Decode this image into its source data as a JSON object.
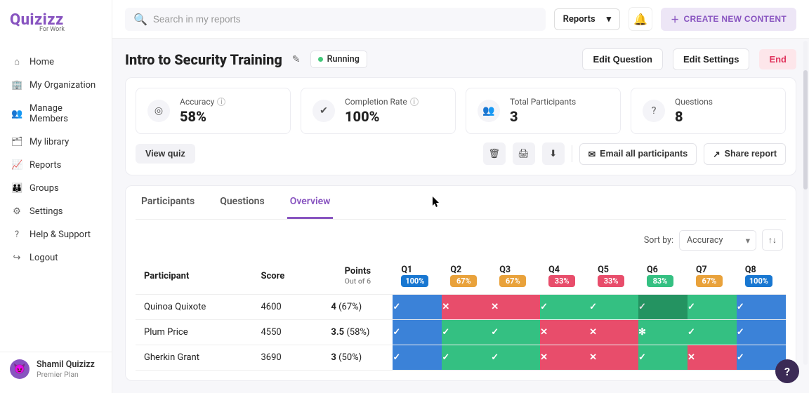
{
  "brand": {
    "name": "Quizizz",
    "tagline": "For Work"
  },
  "sidebar": {
    "items": [
      {
        "icon": "⌂",
        "name": "home",
        "label": "Home"
      },
      {
        "icon": "🏢",
        "name": "org",
        "label": "My Organization"
      },
      {
        "icon": "👥",
        "name": "members",
        "label": "Manage Members"
      },
      {
        "icon": "🗂",
        "name": "library",
        "label": "My library"
      },
      {
        "icon": "📈",
        "name": "reports",
        "label": "Reports"
      },
      {
        "icon": "👪",
        "name": "groups",
        "label": "Groups"
      },
      {
        "icon": "⚙",
        "name": "settings",
        "label": "Settings"
      },
      {
        "icon": "?",
        "name": "help",
        "label": "Help & Support"
      },
      {
        "icon": "↪",
        "name": "logout",
        "label": "Logout"
      }
    ]
  },
  "user": {
    "name": "Shamil Quizizz",
    "plan": "Premier Plan",
    "avatar": "😈"
  },
  "topbar": {
    "search_placeholder": "Search in my reports",
    "dropdown_label": "Reports",
    "create_label": "CREATE NEW CONTENT"
  },
  "page": {
    "title": "Intro to Security Training",
    "status": "Running",
    "buttons": {
      "edit_q": "Edit Question",
      "edit_s": "Edit Settings",
      "end": "End"
    }
  },
  "stats": {
    "accuracy": {
      "label": "Accuracy",
      "value": "58%"
    },
    "completion": {
      "label": "Completion Rate",
      "value": "100%"
    },
    "participants": {
      "label": "Total Participants",
      "value": "3"
    },
    "questions": {
      "label": "Questions",
      "value": "8"
    }
  },
  "action_buttons": {
    "view_quiz": "View quiz",
    "email_all": "Email all participants",
    "share": "Share report"
  },
  "tabs": [
    "Participants",
    "Questions",
    "Overview"
  ],
  "active_tab": 2,
  "sort": {
    "label": "Sort by:",
    "value": "Accuracy"
  },
  "table": {
    "headers": {
      "participant": "Participant",
      "score": "Score",
      "points": "Points",
      "points_sub": "Out of 6"
    },
    "questions": [
      {
        "label": "Q1",
        "pct": "100%",
        "color": "blue"
      },
      {
        "label": "Q2",
        "pct": "67%",
        "color": "orange"
      },
      {
        "label": "Q3",
        "pct": "67%",
        "color": "orange"
      },
      {
        "label": "Q4",
        "pct": "33%",
        "color": "red"
      },
      {
        "label": "Q5",
        "pct": "33%",
        "color": "red"
      },
      {
        "label": "Q6",
        "pct": "83%",
        "color": "green"
      },
      {
        "label": "Q7",
        "pct": "67%",
        "color": "orange"
      },
      {
        "label": "Q8",
        "pct": "100%",
        "color": "blue"
      }
    ],
    "rows": [
      {
        "name": "Quinoa Quixote",
        "score": "4600",
        "points": "4",
        "pct": "(67%)",
        "cells": [
          {
            "c": "blue",
            "m": "✓"
          },
          {
            "c": "red",
            "m": "✕"
          },
          {
            "c": "red",
            "m": "✕"
          },
          {
            "c": "green",
            "m": "✓"
          },
          {
            "c": "green",
            "m": "✓"
          },
          {
            "c": "dgreen",
            "m": "✓"
          },
          {
            "c": "green",
            "m": "✓"
          },
          {
            "c": "blue",
            "m": "✓"
          }
        ]
      },
      {
        "name": "Plum Price",
        "score": "4550",
        "points": "3.5",
        "pct": "(58%)",
        "cells": [
          {
            "c": "blue",
            "m": "✓"
          },
          {
            "c": "green",
            "m": "✓"
          },
          {
            "c": "green",
            "m": "✓"
          },
          {
            "c": "red",
            "m": "✕"
          },
          {
            "c": "red",
            "m": "✕"
          },
          {
            "c": "green",
            "m": "✻"
          },
          {
            "c": "green",
            "m": "✓"
          },
          {
            "c": "blue",
            "m": "✓"
          }
        ]
      },
      {
        "name": "Gherkin Grant",
        "score": "3690",
        "points": "3",
        "pct": "(50%)",
        "cells": [
          {
            "c": "blue",
            "m": "✓"
          },
          {
            "c": "green",
            "m": "✓"
          },
          {
            "c": "green",
            "m": "✓"
          },
          {
            "c": "red",
            "m": "✕"
          },
          {
            "c": "red",
            "m": "✕"
          },
          {
            "c": "green",
            "m": "✓"
          },
          {
            "c": "red",
            "m": "✕"
          },
          {
            "c": "blue",
            "m": "✓"
          }
        ]
      }
    ]
  }
}
